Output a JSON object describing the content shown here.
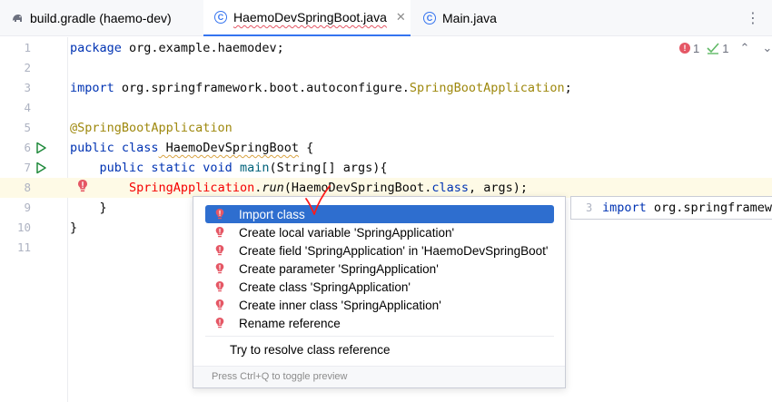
{
  "tabs": [
    {
      "label": "build.gradle (haemo-dev)",
      "icon": "gradle-elephant-icon"
    },
    {
      "label": "HaemoDevSpringBoot.java",
      "icon": "class-c-icon",
      "close": "✕"
    },
    {
      "label": "Main.java",
      "icon": "class-c-icon"
    }
  ],
  "inspection": {
    "errors": "1",
    "warnings": "1"
  },
  "lines": [
    {
      "n": "1"
    },
    {
      "n": "2"
    },
    {
      "n": "3"
    },
    {
      "n": "4"
    },
    {
      "n": "5"
    },
    {
      "n": "6"
    },
    {
      "n": "7"
    },
    {
      "n": "8"
    },
    {
      "n": "9"
    },
    {
      "n": "10"
    },
    {
      "n": "11"
    }
  ],
  "code": {
    "l1_kw": "package",
    "l1_rest": " org.example.haemodev;",
    "l3_kw": "import",
    "l3_pkg": " org.springframework.boot.autoconfigure.",
    "l3_cls": "SpringBootApplication",
    "l3_end": ";",
    "l5_ann": "@SpringBootApplication",
    "l6_kw": "public class",
    "l6_name": " HaemoDevSpringBoot",
    "l6_end": " {",
    "l7_indent": "    ",
    "l7_kw": "public static void",
    "l7_method": " main",
    "l7_rest": "(String[] args){",
    "l8_indent": "        ",
    "l8_ref": "SpringApplication",
    "l8_dot": ".",
    "l8_run": "run",
    "l8_open": "(",
    "l8_cls": "HaemoDevSpringBoot",
    "l8_dot2": ".",
    "l8_classkw": "class",
    "l8_end": ", args);",
    "l9": "    }",
    "l10": "}"
  },
  "popup": {
    "items": [
      {
        "label": "Import class",
        "selected": true
      },
      {
        "label": "Create local variable 'SpringApplication'"
      },
      {
        "label": "Create field 'SpringApplication' in 'HaemoDevSpringBoot'"
      },
      {
        "label": "Create parameter 'SpringApplication'"
      },
      {
        "label": "Create class 'SpringApplication'"
      },
      {
        "label": "Create inner class 'SpringApplication'"
      },
      {
        "label": "Rename reference"
      }
    ],
    "resolve": "Try to resolve class reference",
    "footer": "Press Ctrl+Q to toggle preview"
  },
  "preview": {
    "line": "3",
    "code": "import org.springframework.boot.autoconfigure.SpringBootApplication;"
  },
  "colors": {
    "accent": "#3574f0",
    "error": "#e55765",
    "selection": "#2e6ecf",
    "keyword": "#0033b3",
    "annotation": "#9e880d"
  }
}
